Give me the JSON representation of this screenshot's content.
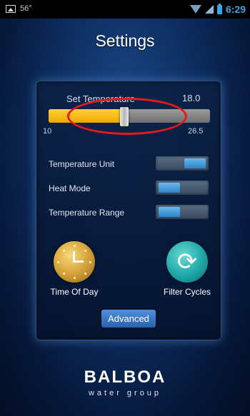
{
  "status_bar": {
    "temperature": "56°",
    "time": "6:29"
  },
  "title": "Settings",
  "set_temperature": {
    "label": "Set Temperature",
    "value": "18.0",
    "min": "10",
    "max": "26.5",
    "level_fraction": 0.47
  },
  "settings": [
    {
      "label": "Temperature Unit",
      "state": "on"
    },
    {
      "label": "Heat Mode",
      "state": "off"
    },
    {
      "label": "Temperature Range",
      "state": "off"
    }
  ],
  "time_of_day": {
    "label": "Time Of Day"
  },
  "filter_cycles": {
    "label": "Filter Cycles"
  },
  "advanced_button": {
    "label": "Advanced"
  },
  "logo": {
    "wordmark": "BALBOA",
    "tagline": "water group"
  },
  "colors": {
    "slider_fill": "#f0a800",
    "toggle_accent": "#2b84c8",
    "highlight_ring": "#e21b1b",
    "status_accent": "#3aa3e6"
  },
  "icons": {
    "status_left": [
      "image-icon"
    ],
    "status_right": [
      "wifi-icon",
      "signal-icon",
      "battery-icon"
    ],
    "time_of_day": "clock-icon",
    "filter_cycles": "refresh-icon"
  }
}
